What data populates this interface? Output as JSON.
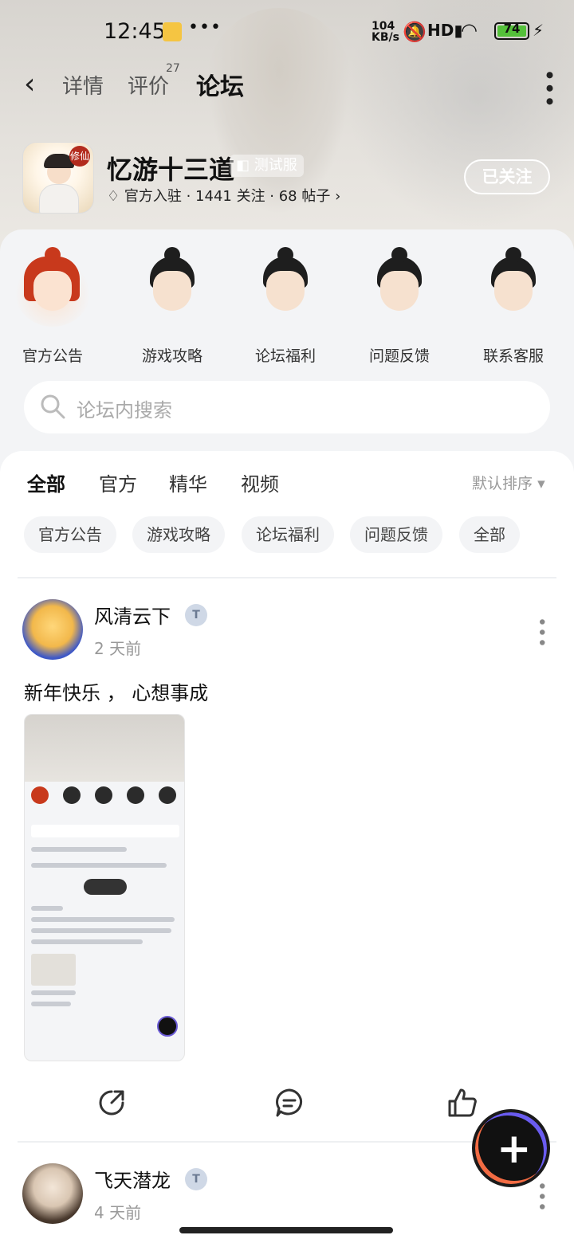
{
  "status_bar": {
    "time": "12:45",
    "dots": "•••",
    "speed_top": "104",
    "speed_bottom": "KB/s",
    "signal": "HD",
    "battery": "74"
  },
  "nav": {
    "tabs": [
      {
        "label": "详情"
      },
      {
        "label": "评价",
        "sup": "27"
      },
      {
        "label": "论坛"
      }
    ]
  },
  "game": {
    "icon_tag": "修仙",
    "name": "忆游十三道",
    "test_badge": "测试服",
    "stats": "官方入驻 · 1441 关注 · 68 帖子",
    "follow_label": "已关注"
  },
  "shortcuts": [
    {
      "label": "官方公告"
    },
    {
      "label": "游戏攻略"
    },
    {
      "label": "论坛福利"
    },
    {
      "label": "问题反馈"
    },
    {
      "label": "联系客服"
    }
  ],
  "search": {
    "placeholder": "论坛内搜索"
  },
  "feed_tabs": [
    {
      "label": "全部"
    },
    {
      "label": "官方"
    },
    {
      "label": "精华"
    },
    {
      "label": "视频"
    }
  ],
  "sort_label": "默认排序",
  "chips": [
    {
      "label": "官方公告"
    },
    {
      "label": "游戏攻略"
    },
    {
      "label": "论坛福利"
    },
    {
      "label": "问题反馈"
    },
    {
      "label": "全部"
    }
  ],
  "posts": [
    {
      "author": "风清云下",
      "time": "2 天前",
      "text": "新年快乐 ， 心想事成"
    },
    {
      "author": "飞天潜龙",
      "time": "4 天前"
    }
  ],
  "colors": {
    "accent": "#25d3b4"
  }
}
